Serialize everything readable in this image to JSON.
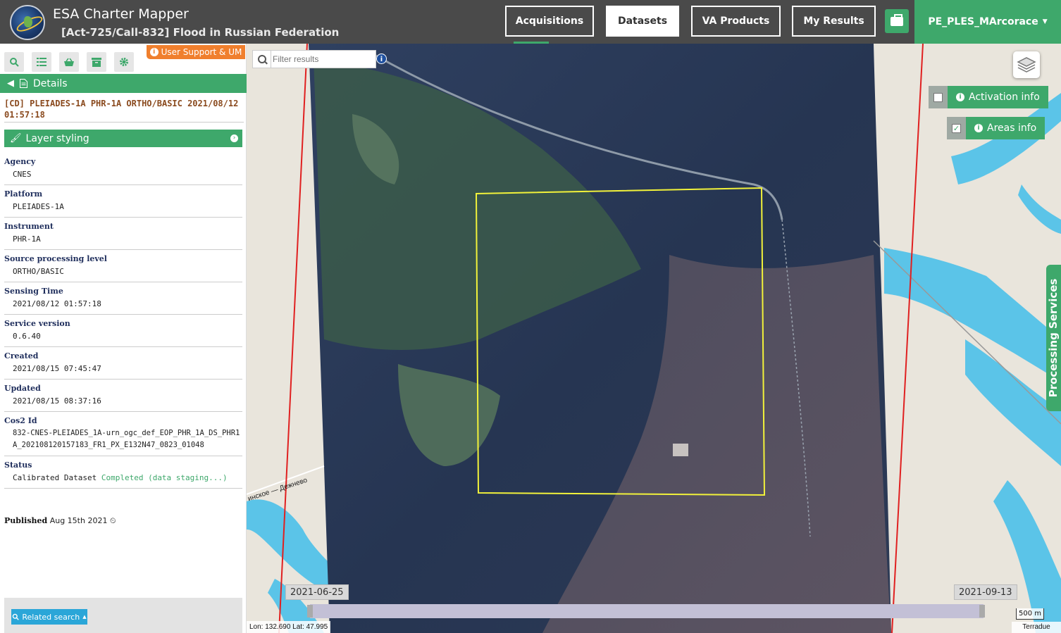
{
  "header": {
    "app_title": "ESA Charter Mapper",
    "activation_title": "[Act-725/Call-832] Flood in Russian Federation",
    "nav": [
      "Acquisitions",
      "Datasets",
      "VA Products",
      "My Results"
    ],
    "active_nav": "Datasets",
    "user": "PE_PLES_MArcorace"
  },
  "left_panel": {
    "support_label": "User Support & UM",
    "details_label": "Details",
    "dataset_title": "[CD] PLEIADES-1A PHR-1A ORTHO/BASIC 2021/08/12 01:57:18",
    "layer_styling_label": "Layer styling",
    "metadata": [
      {
        "label": "Agency",
        "value": "CNES"
      },
      {
        "label": "Platform",
        "value": "PLEIADES-1A"
      },
      {
        "label": "Instrument",
        "value": "PHR-1A"
      },
      {
        "label": "Source processing level",
        "value": "ORTHO/BASIC"
      },
      {
        "label": "Sensing Time",
        "value": "2021/08/12 01:57:18"
      },
      {
        "label": "Service version",
        "value": "0.6.40"
      },
      {
        "label": "Created",
        "value": "2021/08/15 07:45:47"
      },
      {
        "label": "Updated",
        "value": "2021/08/15 08:37:16"
      },
      {
        "label": "Cos2 Id",
        "value": "832-CNES-PLEIADES_1A-urn_ogc_def_EOP_PHR_1A_DS_PHR1A_202108120157183_FR1_PX_E132N47_0823_01048"
      },
      {
        "label": "Status",
        "value": "Calibrated Dataset",
        "status_text": "Completed (data staging...)"
      }
    ],
    "published_label": "Published",
    "published_date": "Aug 15th 2021",
    "related_search_label": "Related search"
  },
  "map": {
    "filter_placeholder": "Filter results",
    "activation_info_label": "Activation info",
    "areas_info_label": "Areas info",
    "activation_info_checked": false,
    "areas_info_checked": true,
    "processing_services_label": "Processing Services",
    "timeline_start": "2021-06-25",
    "timeline_end": "2021-09-13",
    "scale_label": "500 m",
    "coordinates": "Lon: 132.690 Lat: 47.995",
    "attribution": "Terradue",
    "road_label": "инское — Дежнево",
    "colors": {
      "water": "#5bc4e8",
      "aoi_outline": "#f2f23a",
      "footprint_line": "#e02020",
      "accent": "#3ea86b"
    }
  }
}
